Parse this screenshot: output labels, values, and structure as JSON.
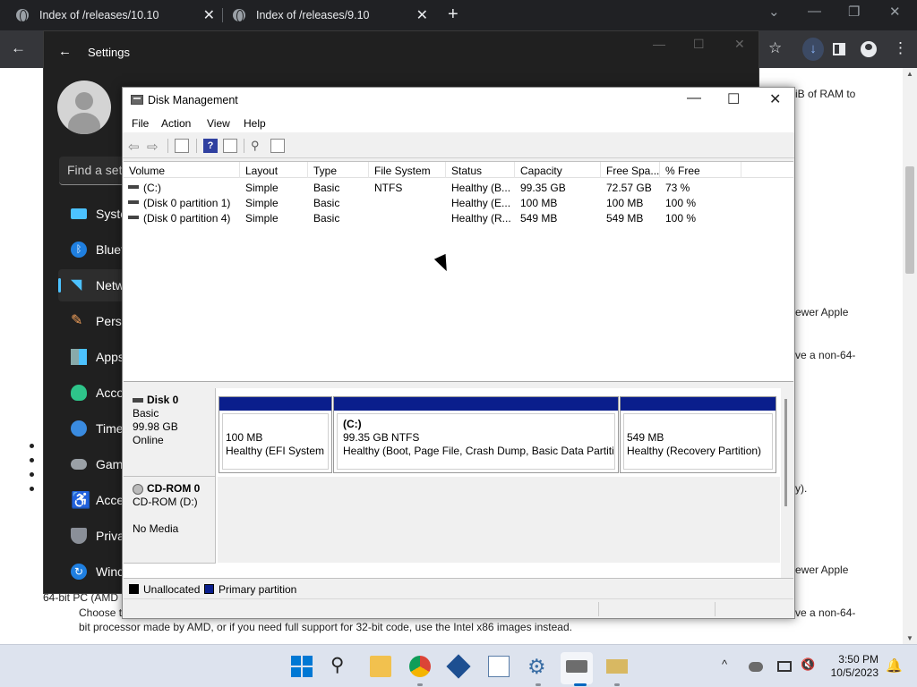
{
  "browser": {
    "tabs": [
      {
        "title": "Index of /releases/10.10",
        "close": "✕"
      },
      {
        "title": "Index of /releases/9.10",
        "close": "✕"
      }
    ],
    "new_tab": "+",
    "window_controls": {
      "minimize": "—",
      "restore": "❐",
      "close": "✕",
      "collapse": "⌄"
    },
    "toolbar": {
      "back": "←",
      "star": "☆",
      "menu": "⋮"
    }
  },
  "page": {
    "fragments": [
      "iB of RAM to",
      "ewer Apple",
      "ve a non-64-",
      "y).",
      "ewer Apple",
      "ve a non-64-",
      "64-bit PC (AMD",
      "Choose t",
      "bit processor made by AMD, or if you need full support for 32-bit code, use the Intel x86 images instead."
    ]
  },
  "settings": {
    "title": "Settings",
    "back": "←",
    "search_placeholder": "Find a setting",
    "controls": {
      "minimize": "—",
      "maximize": "☐",
      "close": "✕"
    },
    "nav": [
      {
        "label": "System",
        "icon": "system-icon"
      },
      {
        "label": "Bluetooth & devices",
        "icon": "bluetooth-icon"
      },
      {
        "label": "Network & internet",
        "icon": "wifi-icon",
        "selected": true
      },
      {
        "label": "Personalization",
        "icon": "brush-icon"
      },
      {
        "label": "Apps",
        "icon": "apps-icon"
      },
      {
        "label": "Accounts",
        "icon": "account-icon"
      },
      {
        "label": "Time & language",
        "icon": "globe-clock-icon"
      },
      {
        "label": "Gaming",
        "icon": "gamepad-icon"
      },
      {
        "label": "Accessibility",
        "icon": "accessibility-icon"
      },
      {
        "label": "Privacy & security",
        "icon": "shield-icon"
      },
      {
        "label": "Windows Update",
        "icon": "update-icon"
      }
    ]
  },
  "disk_mgmt": {
    "title": "Disk Management",
    "controls": {
      "minimize": "—",
      "maximize": "☐",
      "close": "✕"
    },
    "menu": [
      "File",
      "Action",
      "View",
      "Help"
    ],
    "columns": [
      "Volume",
      "Layout",
      "Type",
      "File System",
      "Status",
      "Capacity",
      "Free Spa...",
      "% Free"
    ],
    "volumes": [
      [
        "(C:)",
        "Simple",
        "Basic",
        "NTFS",
        "Healthy (B...",
        "99.35 GB",
        "72.57 GB",
        "73 %"
      ],
      [
        "(Disk 0 partition 1)",
        "Simple",
        "Basic",
        "",
        "Healthy (E...",
        "100 MB",
        "100 MB",
        "100 %"
      ],
      [
        "(Disk 0 partition 4)",
        "Simple",
        "Basic",
        "",
        "Healthy (R...",
        "549 MB",
        "549 MB",
        "100 %"
      ]
    ],
    "disks": [
      {
        "name": "Disk 0",
        "type": "Basic",
        "size": "99.98 GB",
        "state": "Online",
        "partitions": [
          {
            "title": "",
            "size": "100 MB",
            "status": "Healthy (EFI System P"
          },
          {
            "title": "(C:)",
            "size": "99.35 GB NTFS",
            "status": "Healthy (Boot, Page File, Crash Dump, Basic Data Partition"
          },
          {
            "title": "",
            "size": "549 MB",
            "status": "Healthy (Recovery Partition)"
          }
        ]
      },
      {
        "name": "CD-ROM 0",
        "type": "CD-ROM (D:)",
        "size": "",
        "state": "No Media"
      }
    ],
    "legend": [
      {
        "label": "Unallocated",
        "color": "#000000"
      },
      {
        "label": "Primary partition",
        "color": "#0a1e8c"
      }
    ]
  },
  "taskbar": {
    "apps": [
      "start-icon",
      "search-icon",
      "file-explorer-icon",
      "chrome-icon",
      "virtualbox-icon",
      "performance-monitor-icon",
      "settings-gear-icon",
      "disk-management-icon",
      "media-creation-icon"
    ],
    "tray": {
      "chevron": "^"
    },
    "time": "3:50 PM",
    "date": "10/5/2023"
  }
}
